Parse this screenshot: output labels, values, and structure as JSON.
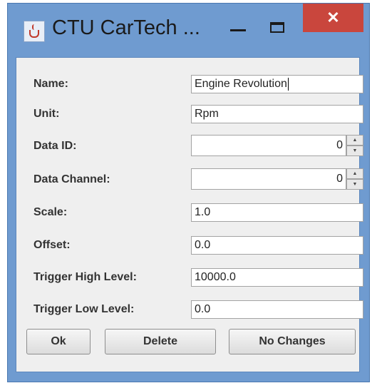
{
  "window": {
    "title": "CTU CarTech ...",
    "close_symbol": "✕"
  },
  "form": {
    "fields": [
      {
        "label": "Name:",
        "value": "Engine Revolution"
      },
      {
        "label": "Unit:",
        "value": "Rpm"
      },
      {
        "label": "Data ID:",
        "value": "0"
      },
      {
        "label": "Data Channel:",
        "value": "0"
      },
      {
        "label": "Scale:",
        "value": "1.0"
      },
      {
        "label": "Offset:",
        "value": "0.0"
      },
      {
        "label": "Trigger High Level:",
        "value": "10000.0"
      },
      {
        "label": "Trigger Low Level:",
        "value": "0.0"
      }
    ]
  },
  "buttons": {
    "ok": "Ok",
    "delete": "Delete",
    "no_changes": "No Changes"
  },
  "icons": {
    "app": "java-cup-icon",
    "minimize": "minimize-icon",
    "maximize": "maximize-icon",
    "close": "close-icon",
    "spin_up": "arrow-up-icon",
    "spin_down": "arrow-down-icon"
  },
  "colors": {
    "titlebar": "#6f9bd0",
    "close": "#c9463d",
    "panel": "#efefef"
  }
}
